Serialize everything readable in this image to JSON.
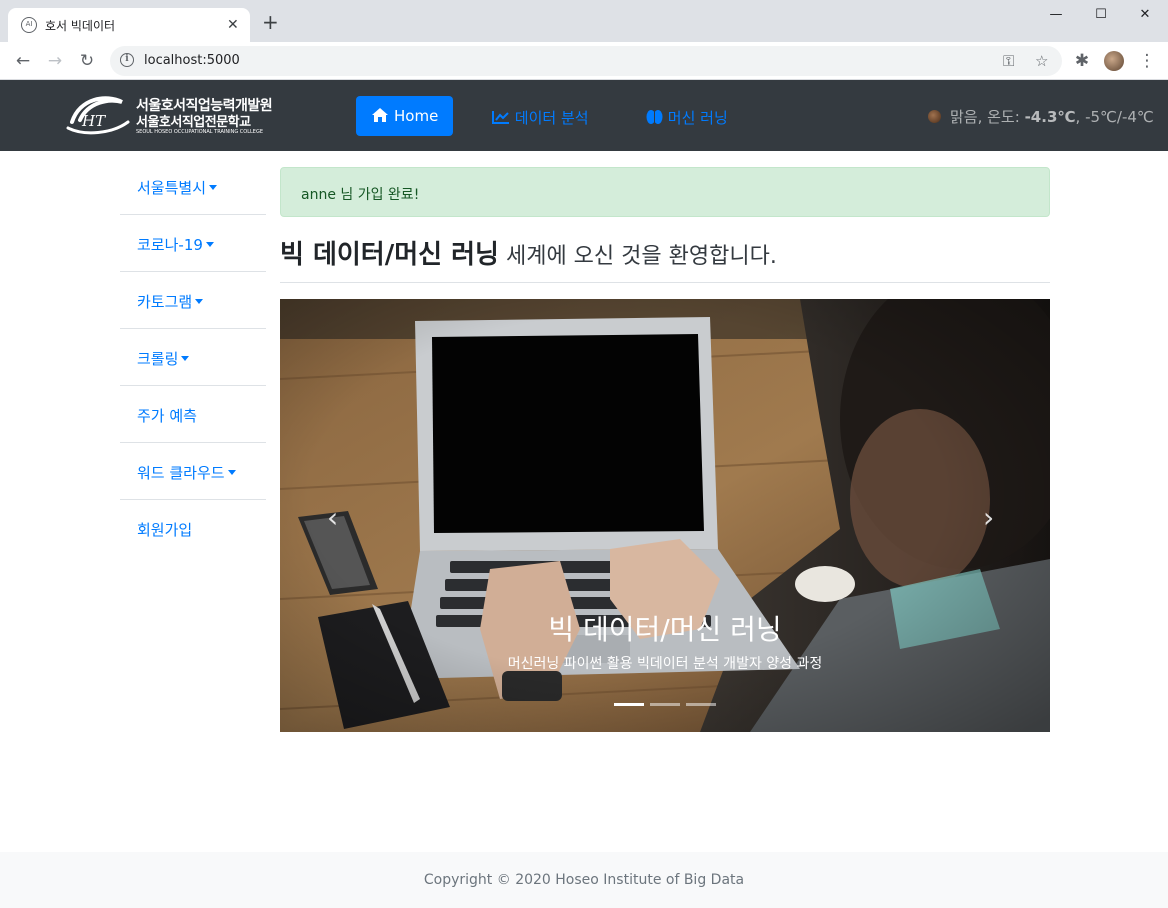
{
  "browser": {
    "tab_title": "호서 빅데이터",
    "tab_favicon": "AI",
    "url": "localhost:5000",
    "window_controls": {
      "minimize": "—",
      "maximize": "☐",
      "close": "✕"
    }
  },
  "navbar": {
    "logo": {
      "line1": "서울호서직업능력개발원",
      "line2": "서울호서직업전문학교",
      "line3": "SEOUL HOSEO OCCUPATIONAL TRAINING COLLEGE"
    },
    "home_label": "Home",
    "links": [
      "데이터 분석",
      "머신 러닝"
    ],
    "weather": {
      "desc": "맑음, 온도:",
      "temp": "-4.3℃",
      "range": ", -5℃/-4℃"
    }
  },
  "sidebar": {
    "items": [
      {
        "label": "서울특별시",
        "dropdown": true
      },
      {
        "label": "코로나-19",
        "dropdown": true
      },
      {
        "label": "카토그램",
        "dropdown": true
      },
      {
        "label": "크롤링",
        "dropdown": true
      },
      {
        "label": "주가 예측",
        "dropdown": false
      },
      {
        "label": "워드 클라우드",
        "dropdown": true
      },
      {
        "label": "회원가입",
        "dropdown": false
      }
    ]
  },
  "main": {
    "alert": "anne 님 가입 완료!",
    "headline_strong": "빅 데이터/머신 러닝",
    "headline_rest": " 세계에 오신 것을 환영합니다.",
    "carousel": {
      "caption_title": "빅 데이터/머신 러닝",
      "caption_text": "머신러닝 파이썬 활용 빅데이터 분석 개발자 양성 과정",
      "slides": 3,
      "active_slide": 1,
      "image": "laptop-on-wooden-desk"
    }
  },
  "footer": {
    "copyright": "Copyright © 2020 Hoseo Institute of Big Data"
  }
}
